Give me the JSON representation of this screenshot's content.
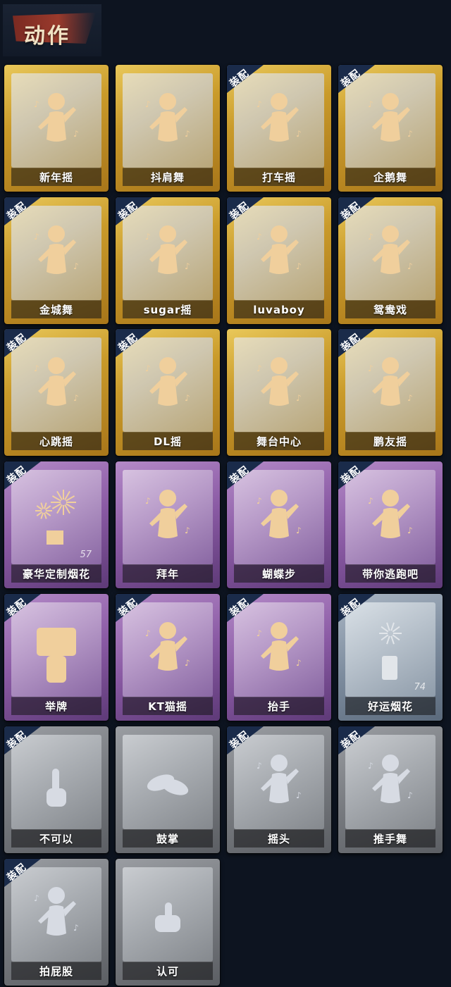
{
  "section": {
    "title": "动作"
  },
  "equip_tag": "装配",
  "cards": [
    {
      "name": "新年摇",
      "tier": "gold",
      "equipped": false,
      "icon": "dancer-icon"
    },
    {
      "name": "抖肩舞",
      "tier": "gold",
      "equipped": false,
      "icon": "dancer-icon"
    },
    {
      "name": "打车摇",
      "tier": "gold",
      "equipped": true,
      "icon": "dancer-icon"
    },
    {
      "name": "企鹅舞",
      "tier": "gold",
      "equipped": true,
      "icon": "dancer-icon"
    },
    {
      "name": "金城舞",
      "tier": "gold",
      "equipped": true,
      "icon": "dancer-icon"
    },
    {
      "name": "sugar摇",
      "tier": "gold",
      "equipped": true,
      "icon": "dancer-icon"
    },
    {
      "name": "luvaboy",
      "tier": "gold",
      "equipped": true,
      "icon": "dancer-icon"
    },
    {
      "name": "鸳鸯戏",
      "tier": "gold",
      "equipped": true,
      "icon": "dancer-icon"
    },
    {
      "name": "心跳摇",
      "tier": "gold",
      "equipped": true,
      "icon": "dancer-icon"
    },
    {
      "name": "DL摇",
      "tier": "gold",
      "equipped": true,
      "icon": "dancer-icon"
    },
    {
      "name": "舞台中心",
      "tier": "gold",
      "equipped": false,
      "icon": "dancer-icon"
    },
    {
      "name": "鹏友摇",
      "tier": "gold",
      "equipped": true,
      "icon": "dancer-icon"
    },
    {
      "name": "豪华定制烟花",
      "tier": "purple",
      "equipped": true,
      "icon": "fireworks-icon",
      "count": "57"
    },
    {
      "name": "拜年",
      "tier": "purple",
      "equipped": false,
      "icon": "dancer-icon"
    },
    {
      "name": "蝴蝶步",
      "tier": "purple",
      "equipped": true,
      "icon": "dancer-icon"
    },
    {
      "name": "带你逃跑吧",
      "tier": "purple",
      "equipped": true,
      "icon": "dancer-icon"
    },
    {
      "name": "举牌",
      "tier": "purple",
      "equipped": true,
      "icon": "sign-icon"
    },
    {
      "name": "KT猫摇",
      "tier": "purple",
      "equipped": true,
      "icon": "dancer-icon"
    },
    {
      "name": "抬手",
      "tier": "purple",
      "equipped": true,
      "icon": "dancer-icon"
    },
    {
      "name": "好运烟花",
      "tier": "blue",
      "equipped": true,
      "icon": "firework-can-icon",
      "count": "74"
    },
    {
      "name": "不可以",
      "tier": "gray",
      "equipped": true,
      "icon": "finger-icon"
    },
    {
      "name": "鼓掌",
      "tier": "gray",
      "equipped": false,
      "icon": "clap-icon"
    },
    {
      "name": "摇头",
      "tier": "gray",
      "equipped": true,
      "icon": "dancer-icon"
    },
    {
      "name": "推手舞",
      "tier": "gray",
      "equipped": true,
      "icon": "dancer-icon"
    },
    {
      "name": "拍屁股",
      "tier": "gray",
      "equipped": true,
      "icon": "dancer-icon"
    },
    {
      "name": "认可",
      "tier": "gray",
      "equipped": false,
      "icon": "thumbs-up-icon"
    }
  ]
}
